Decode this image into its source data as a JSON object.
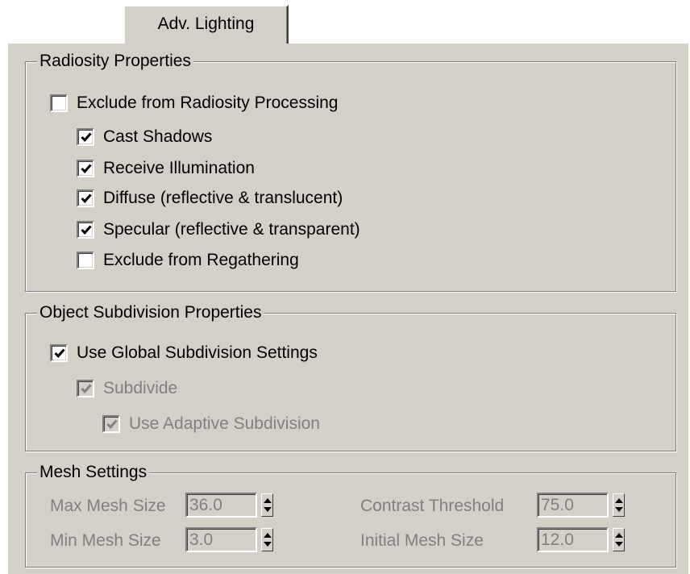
{
  "tab": {
    "label": "Adv. Lighting"
  },
  "radiosity": {
    "title": "Radiosity Properties",
    "exclude_processing": {
      "label": "Exclude from Radiosity Processing",
      "checked": false
    },
    "cast_shadows": {
      "label": "Cast Shadows",
      "checked": true
    },
    "receive_illumination": {
      "label": "Receive Illumination",
      "checked": true
    },
    "diffuse": {
      "label": "Diffuse (reflective & translucent)",
      "checked": true
    },
    "specular": {
      "label": "Specular (reflective & transparent)",
      "checked": true
    },
    "exclude_regathering": {
      "label": "Exclude from Regathering",
      "checked": false
    }
  },
  "subdivision": {
    "title": "Object Subdivision Properties",
    "use_global": {
      "label": "Use Global Subdivision Settings",
      "checked": true
    },
    "subdivide": {
      "label": "Subdivide",
      "checked": true,
      "disabled": true
    },
    "adaptive": {
      "label": "Use Adaptive Subdivision",
      "checked": true,
      "disabled": true
    }
  },
  "mesh": {
    "title": "Mesh Settings",
    "max_mesh_size": {
      "label": "Max Mesh Size",
      "value": "36.0"
    },
    "min_mesh_size": {
      "label": "Min Mesh Size",
      "value": "3.0"
    },
    "contrast_threshold": {
      "label": "Contrast Threshold",
      "value": "75.0"
    },
    "initial_mesh_size": {
      "label": "Initial Mesh Size",
      "value": "12.0"
    }
  },
  "colors": {
    "panel_bg": "#d4d0c8",
    "disabled_text": "#808080"
  }
}
